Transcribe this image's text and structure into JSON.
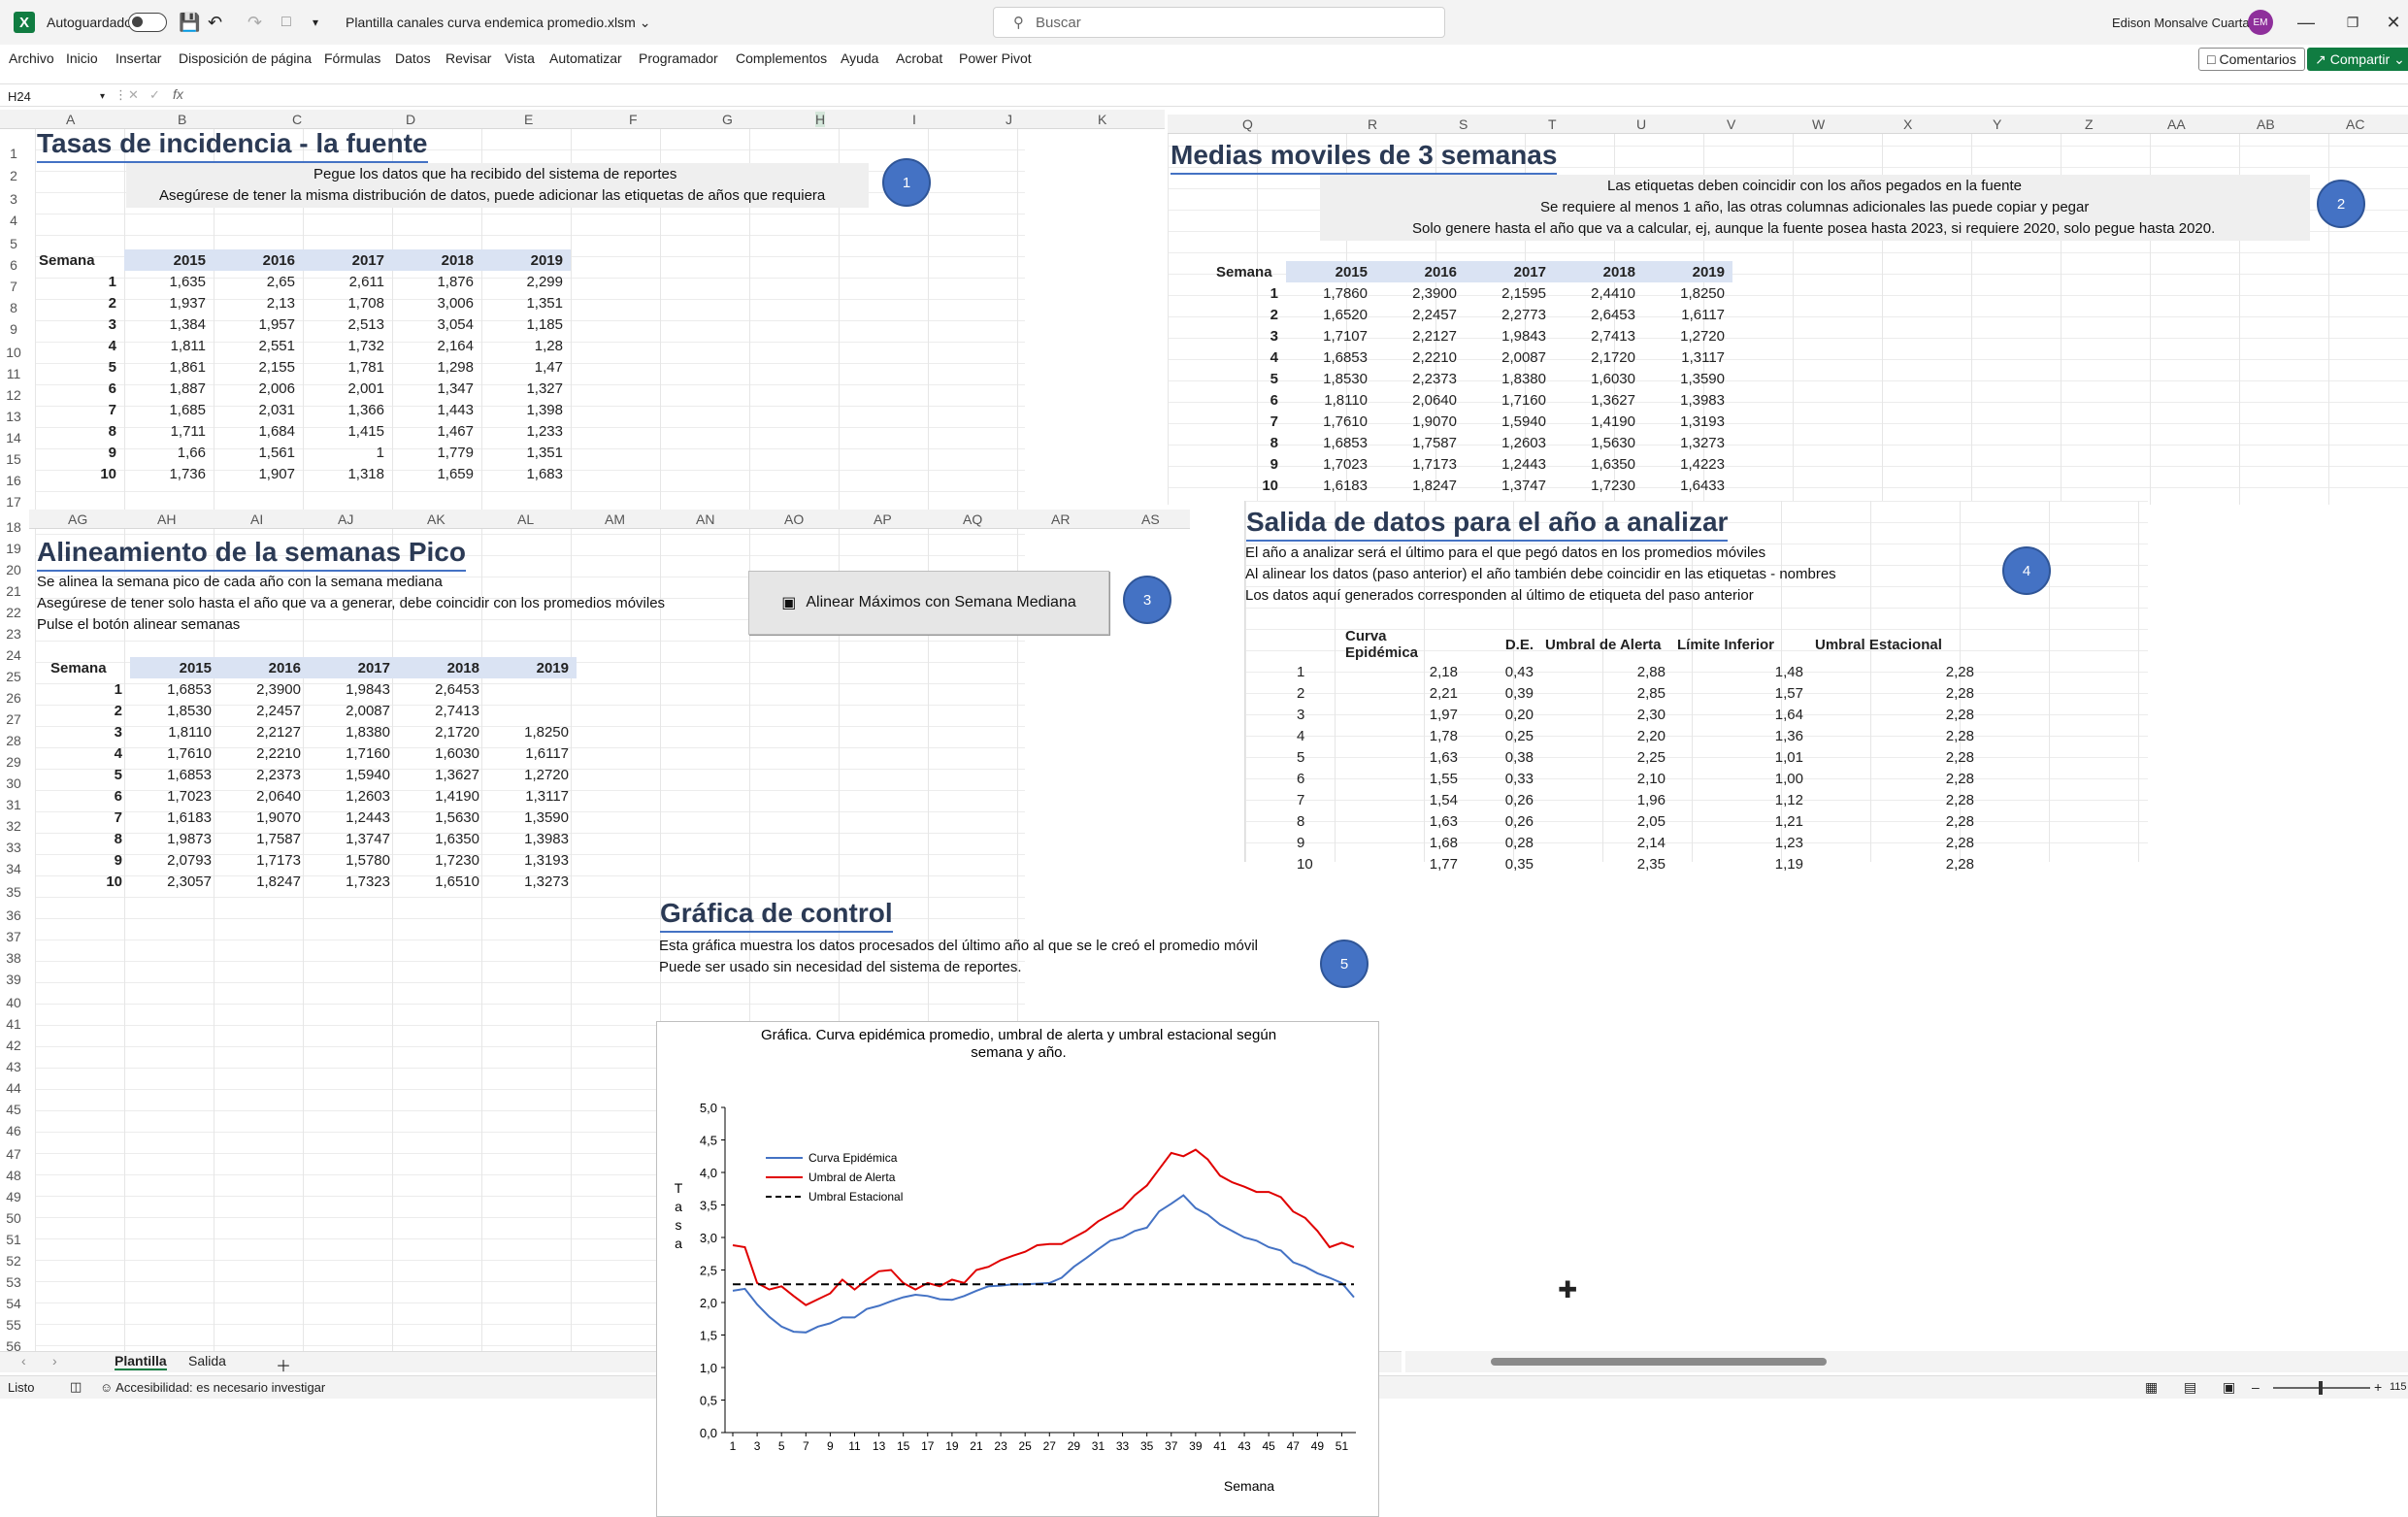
{
  "titlebar": {
    "app_logo": "X",
    "autosave_label": "Autoguardado",
    "filename": "Plantilla canales curva endemica promedio.xlsm",
    "search_placeholder": "Buscar",
    "user_name": "Edison Monsalve Cuartas",
    "user_initials": "EM"
  },
  "menu": [
    "Archivo",
    "Inicio",
    "Insertar",
    "Disposición de página",
    "Fórmulas",
    "Datos",
    "Revisar",
    "Vista",
    "Automatizar",
    "Programador",
    "Complementos",
    "Ayuda",
    "Acrobat",
    "Power Pivot"
  ],
  "ribbon_buttons": {
    "comments": "Comentarios",
    "share": "Compartir"
  },
  "formula_bar": {
    "cell_ref": "H24",
    "fx": "fx"
  },
  "col_headers_top": [
    "A",
    "B",
    "C",
    "D",
    "E",
    "F",
    "G",
    "H",
    "I",
    "J",
    "K"
  ],
  "col_headers_top_right": [
    "Q",
    "R",
    "S",
    "T",
    "U",
    "V",
    "W",
    "X",
    "Y",
    "Z",
    "AA",
    "AB",
    "AC"
  ],
  "col_headers_mid": [
    "AG",
    "AH",
    "AI",
    "AJ",
    "AK",
    "AL",
    "AM",
    "AN",
    "AO",
    "AP",
    "AQ",
    "AR",
    "AS"
  ],
  "row_numbers": [
    "1",
    "2",
    "3",
    "4",
    "5",
    "6",
    "7",
    "8",
    "9",
    "10",
    "11",
    "12",
    "13",
    "14",
    "15",
    "16",
    "17",
    "18",
    "19",
    "20",
    "21",
    "22",
    "23",
    "24",
    "25",
    "26",
    "27",
    "28",
    "29",
    "30",
    "31",
    "32",
    "33",
    "34",
    "35",
    "36",
    "37",
    "38",
    "39",
    "40",
    "41",
    "42",
    "43",
    "44",
    "45",
    "46",
    "47",
    "48",
    "49",
    "50",
    "51",
    "52",
    "53",
    "54",
    "55",
    "56"
  ],
  "section1": {
    "title": "Tasas de incidencia - la fuente",
    "note1": "Pegue los datos que ha recibido del sistema de reportes",
    "note2": "Asegúrese de tener la misma distribución de datos, puede adicionar las etiquetas de años que requiera",
    "badge": "1",
    "header": [
      "Semana",
      "2015",
      "2016",
      "2017",
      "2018",
      "2019"
    ],
    "rows": [
      [
        "1",
        "1,635",
        "2,65",
        "2,611",
        "1,876",
        "2,299"
      ],
      [
        "2",
        "1,937",
        "2,13",
        "1,708",
        "3,006",
        "1,351"
      ],
      [
        "3",
        "1,384",
        "1,957",
        "2,513",
        "3,054",
        "1,185"
      ],
      [
        "4",
        "1,811",
        "2,551",
        "1,732",
        "2,164",
        "1,28"
      ],
      [
        "5",
        "1,861",
        "2,155",
        "1,781",
        "1,298",
        "1,47"
      ],
      [
        "6",
        "1,887",
        "2,006",
        "2,001",
        "1,347",
        "1,327"
      ],
      [
        "7",
        "1,685",
        "2,031",
        "1,366",
        "1,443",
        "1,398"
      ],
      [
        "8",
        "1,711",
        "1,684",
        "1,415",
        "1,467",
        "1,233"
      ],
      [
        "9",
        "1,66",
        "1,561",
        "1",
        "1,779",
        "1,351"
      ],
      [
        "10",
        "1,736",
        "1,907",
        "1,318",
        "1,659",
        "1,683"
      ]
    ]
  },
  "section2": {
    "title": "Medias moviles de 3 semanas",
    "note1": "Las etiquetas deben coincidir con los años pegados en la fuente",
    "note2": "Se requiere al menos 1 año, las otras columnas adicionales las puede copiar y pegar",
    "note3": "Solo genere hasta el año que va a calcular, ej, aunque la fuente posea hasta 2023, si requiere 2020, solo pegue hasta 2020.",
    "badge": "2",
    "header": [
      "Semana",
      "2015",
      "2016",
      "2017",
      "2018",
      "2019"
    ],
    "rows": [
      [
        "1",
        "1,7860",
        "2,3900",
        "2,1595",
        "2,4410",
        "1,8250"
      ],
      [
        "2",
        "1,6520",
        "2,2457",
        "2,2773",
        "2,6453",
        "1,6117"
      ],
      [
        "3",
        "1,7107",
        "2,2127",
        "1,9843",
        "2,7413",
        "1,2720"
      ],
      [
        "4",
        "1,6853",
        "2,2210",
        "2,0087",
        "2,1720",
        "1,3117"
      ],
      [
        "5",
        "1,8530",
        "2,2373",
        "1,8380",
        "1,6030",
        "1,3590"
      ],
      [
        "6",
        "1,8110",
        "2,0640",
        "1,7160",
        "1,3627",
        "1,3983"
      ],
      [
        "7",
        "1,7610",
        "1,9070",
        "1,5940",
        "1,4190",
        "1,3193"
      ],
      [
        "8",
        "1,6853",
        "1,7587",
        "1,2603",
        "1,5630",
        "1,3273"
      ],
      [
        "9",
        "1,7023",
        "1,7173",
        "1,2443",
        "1,6350",
        "1,4223"
      ],
      [
        "10",
        "1,6183",
        "1,8247",
        "1,3747",
        "1,7230",
        "1,6433"
      ]
    ]
  },
  "section3": {
    "title": "Alineamiento de la semanas Pico",
    "note1": "Se alinea la semana pico de cada año con la semana mediana",
    "note2": "Asegúrese de tener solo hasta el año que va a generar, debe coincidir con los promedios móviles",
    "note3": "Pulse el botón alinear semanas",
    "button": "Alinear Máximos con Semana Mediana",
    "badge": "3",
    "header": [
      "Semana",
      "2015",
      "2016",
      "2017",
      "2018",
      "2019"
    ],
    "rows": [
      [
        "1",
        "1,6853",
        "2,3900",
        "1,9843",
        "2,6453",
        ""
      ],
      [
        "2",
        "1,8530",
        "2,2457",
        "2,0087",
        "2,7413",
        ""
      ],
      [
        "3",
        "1,8110",
        "2,2127",
        "1,8380",
        "2,1720",
        "1,8250"
      ],
      [
        "4",
        "1,7610",
        "2,2210",
        "1,7160",
        "1,6030",
        "1,6117"
      ],
      [
        "5",
        "1,6853",
        "2,2373",
        "1,5940",
        "1,3627",
        "1,2720"
      ],
      [
        "6",
        "1,7023",
        "2,0640",
        "1,2603",
        "1,4190",
        "1,3117"
      ],
      [
        "7",
        "1,6183",
        "1,9070",
        "1,2443",
        "1,5630",
        "1,3590"
      ],
      [
        "8",
        "1,9873",
        "1,7587",
        "1,3747",
        "1,6350",
        "1,3983"
      ],
      [
        "9",
        "2,0793",
        "1,7173",
        "1,5780",
        "1,7230",
        "1,3193"
      ],
      [
        "10",
        "2,3057",
        "1,8247",
        "1,7323",
        "1,6510",
        "1,3273"
      ]
    ]
  },
  "section4": {
    "title": "Salida de datos para el año a analizar",
    "note1": "El año a analizar será el último para el que pegó datos en los promedios móviles",
    "note2": "Al alinear los datos (paso anterior) el año también debe coincidir en las etiquetas - nombres",
    "note3": "Los datos aquí generados corresponden al último de etiqueta del paso anterior",
    "badge": "4",
    "header": [
      "",
      "Curva Epidémica",
      "D.E.",
      "Umbral de Alerta",
      "Límite Inferior",
      "Umbral Estacional"
    ],
    "rows": [
      [
        "1",
        "2,18",
        "0,43",
        "2,88",
        "1,48",
        "2,28"
      ],
      [
        "2",
        "2,21",
        "0,39",
        "2,85",
        "1,57",
        "2,28"
      ],
      [
        "3",
        "1,97",
        "0,20",
        "2,30",
        "1,64",
        "2,28"
      ],
      [
        "4",
        "1,78",
        "0,25",
        "2,20",
        "1,36",
        "2,28"
      ],
      [
        "5",
        "1,63",
        "0,38",
        "2,25",
        "1,01",
        "2,28"
      ],
      [
        "6",
        "1,55",
        "0,33",
        "2,10",
        "1,00",
        "2,28"
      ],
      [
        "7",
        "1,54",
        "0,26",
        "1,96",
        "1,12",
        "2,28"
      ],
      [
        "8",
        "1,63",
        "0,26",
        "2,05",
        "1,21",
        "2,28"
      ],
      [
        "9",
        "1,68",
        "0,28",
        "2,14",
        "1,23",
        "2,28"
      ],
      [
        "10",
        "1,77",
        "0,35",
        "2,35",
        "1,19",
        "2,28"
      ]
    ]
  },
  "section5": {
    "title": "Gráfica de control",
    "note1": "Esta gráfica muestra los datos procesados del último año al que se le creó el promedio móvil",
    "note2": "Puede ser usado sin necesidad del sistema de reportes.",
    "badge": "5"
  },
  "sheet_tabs": [
    "Plantilla",
    "Salida"
  ],
  "status": {
    "ready": "Listo",
    "accessibility": "Accesibilidad: es necesario investigar",
    "zoom": "115"
  },
  "chart_data": {
    "type": "line",
    "title": "Gráfica. Curva epidémica promedio, umbral de alerta y umbral estacional según semana y año.",
    "xlabel": "Semana",
    "ylabel": "Tasa",
    "ylim": [
      0,
      5
    ],
    "yticks": [
      "0,0",
      "0,5",
      "1,0",
      "1,5",
      "2,0",
      "2,5",
      "3,0",
      "3,5",
      "4,0",
      "4,5",
      "5,0"
    ],
    "xticks": [
      "1",
      "3",
      "5",
      "7",
      "9",
      "11",
      "13",
      "15",
      "17",
      "19",
      "21",
      "23",
      "25",
      "27",
      "29",
      "31",
      "33",
      "35",
      "37",
      "39",
      "41",
      "43",
      "45",
      "47",
      "49",
      "51"
    ],
    "x": [
      1,
      2,
      3,
      4,
      5,
      6,
      7,
      8,
      9,
      10,
      11,
      12,
      13,
      14,
      15,
      16,
      17,
      18,
      19,
      20,
      21,
      22,
      23,
      24,
      25,
      26,
      27,
      28,
      29,
      30,
      31,
      32,
      33,
      34,
      35,
      36,
      37,
      38,
      39,
      40,
      41,
      42,
      43,
      44,
      45,
      46,
      47,
      48,
      49,
      50,
      51,
      52
    ],
    "legend_position": "top-left",
    "series": [
      {
        "name": "Curva Epidémica",
        "color": "#4472c4",
        "style": "solid",
        "values": [
          2.18,
          2.21,
          1.97,
          1.78,
          1.63,
          1.55,
          1.54,
          1.63,
          1.68,
          1.77,
          1.77,
          1.9,
          1.95,
          2.02,
          2.08,
          2.12,
          2.1,
          2.05,
          2.04,
          2.1,
          2.18,
          2.25,
          2.26,
          2.28,
          2.28,
          2.29,
          2.3,
          2.38,
          2.55,
          2.68,
          2.82,
          2.95,
          3.0,
          3.1,
          3.15,
          3.4,
          3.52,
          3.65,
          3.45,
          3.35,
          3.2,
          3.1,
          3.0,
          2.95,
          2.85,
          2.8,
          2.62,
          2.55,
          2.45,
          2.38,
          2.3,
          2.08
        ]
      },
      {
        "name": "Umbral de Alerta",
        "color": "#e00000",
        "style": "solid",
        "values": [
          2.88,
          2.85,
          2.3,
          2.2,
          2.25,
          2.1,
          1.96,
          2.05,
          2.14,
          2.35,
          2.2,
          2.35,
          2.48,
          2.5,
          2.3,
          2.2,
          2.3,
          2.25,
          2.35,
          2.3,
          2.5,
          2.55,
          2.65,
          2.72,
          2.78,
          2.88,
          2.9,
          2.9,
          3.0,
          3.1,
          3.25,
          3.35,
          3.45,
          3.65,
          3.8,
          4.05,
          4.3,
          4.25,
          4.35,
          4.2,
          3.95,
          3.85,
          3.78,
          3.7,
          3.7,
          3.62,
          3.4,
          3.3,
          3.1,
          2.85,
          2.92,
          2.85
        ]
      },
      {
        "name": "Umbral Estacional",
        "color": "#000000",
        "style": "dashed",
        "values": [
          2.28,
          2.28,
          2.28,
          2.28,
          2.28,
          2.28,
          2.28,
          2.28,
          2.28,
          2.28,
          2.28,
          2.28,
          2.28,
          2.28,
          2.28,
          2.28,
          2.28,
          2.28,
          2.28,
          2.28,
          2.28,
          2.28,
          2.28,
          2.28,
          2.28,
          2.28,
          2.28,
          2.28,
          2.28,
          2.28,
          2.28,
          2.28,
          2.28,
          2.28,
          2.28,
          2.28,
          2.28,
          2.28,
          2.28,
          2.28,
          2.28,
          2.28,
          2.28,
          2.28,
          2.28,
          2.28,
          2.28,
          2.28,
          2.28,
          2.28,
          2.28,
          2.28
        ]
      }
    ]
  }
}
